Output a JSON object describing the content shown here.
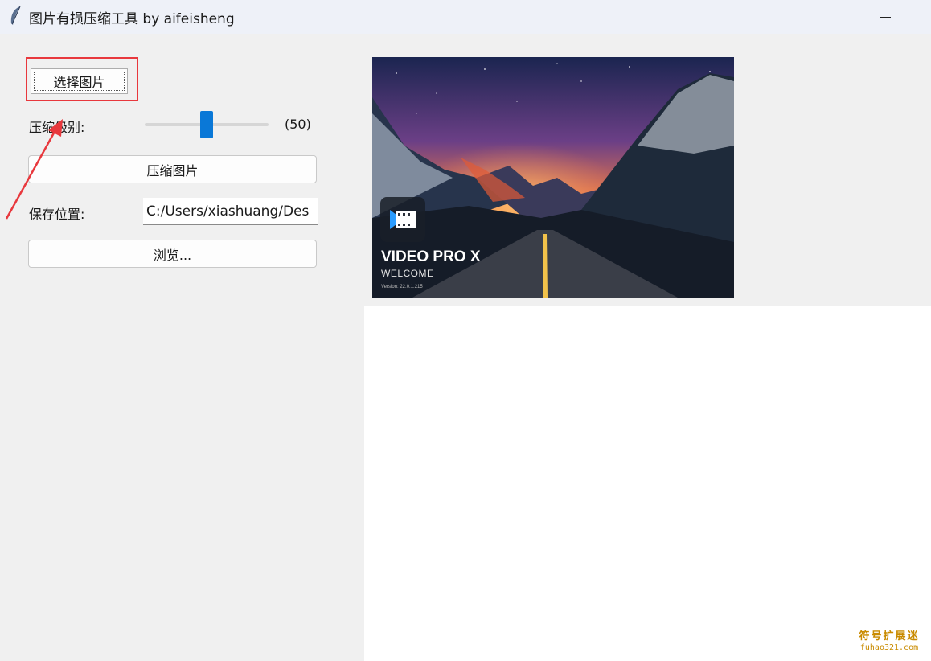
{
  "window": {
    "title": "图片有损压缩工具 by aifeisheng",
    "icon": "feather-icon",
    "minimize_icon": "minimize-icon"
  },
  "controls": {
    "select_button_label": "选择图片",
    "compress_level_label": "压缩级别:",
    "compress_level_value": 50,
    "compress_level_display": "(50)",
    "compress_level_range": [
      0,
      100
    ],
    "compress_button_label": "压缩图片",
    "save_location_label": "保存位置:",
    "save_path_value": "C:/Users/xiashuang/Des",
    "browse_button_label": "浏览..."
  },
  "preview": {
    "title": "VIDEO PRO X",
    "subtitle": "WELCOME",
    "version": "Version: 22.0.1.215"
  },
  "annotation": {
    "highlight_color": "#e8383d",
    "arrow_color": "#e8383d"
  },
  "watermark": {
    "line1": "符号扩展迷",
    "line2": "fuhao321.com"
  },
  "colors": {
    "accent": "#0a78d7",
    "window_bg": "#f0f0f0",
    "titlebar_bg": "#eef1f8"
  }
}
